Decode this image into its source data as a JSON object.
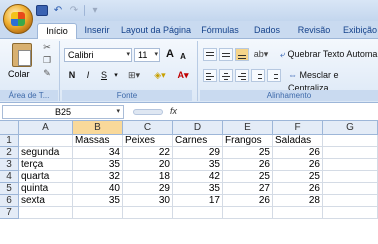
{
  "quick_access": {
    "items": [
      "save-icon",
      "undo-icon",
      "redo-icon",
      "qat-dropdown-icon"
    ]
  },
  "tabs": [
    "Início",
    "Inserir",
    "Layout da Página",
    "Fórmulas",
    "Dados",
    "Revisão",
    "Exibição"
  ],
  "ribbon": {
    "clipboard": {
      "paste_label": "Colar",
      "group_label": "Área de T..."
    },
    "font": {
      "font_name": "Calibri",
      "font_size": "11",
      "bold": "N",
      "italic": "I",
      "underline": "S",
      "grow": "A",
      "shrink": "A",
      "group_label": "Fonte"
    },
    "alignment": {
      "wrap_text": "Quebrar Texto Automa",
      "merge_center": "Mesclar e Centraliza",
      "group_label": "Alinhamento"
    }
  },
  "formula_bar": {
    "name_box": "B25",
    "fx": "fx",
    "content": ""
  },
  "sheet": {
    "columns": [
      "A",
      "B",
      "C",
      "D",
      "E",
      "F",
      "G"
    ],
    "rows": [
      {
        "num": "1",
        "cells": [
          "",
          "Massas",
          "Peixes",
          "Carnes",
          "Frangos",
          "Saladas",
          ""
        ]
      },
      {
        "num": "2",
        "cells": [
          "segunda",
          "34",
          "22",
          "29",
          "25",
          "26",
          ""
        ]
      },
      {
        "num": "3",
        "cells": [
          "terça",
          "35",
          "20",
          "35",
          "26",
          "26",
          ""
        ]
      },
      {
        "num": "4",
        "cells": [
          "quarta",
          "32",
          "18",
          "42",
          "25",
          "25",
          ""
        ]
      },
      {
        "num": "5",
        "cells": [
          "quinta",
          "40",
          "29",
          "35",
          "27",
          "26",
          ""
        ]
      },
      {
        "num": "6",
        "cells": [
          "sexta",
          "35",
          "30",
          "17",
          "26",
          "28",
          ""
        ]
      },
      {
        "num": "7",
        "cells": [
          "",
          "",
          "",
          "",
          "",
          "",
          ""
        ]
      }
    ]
  }
}
